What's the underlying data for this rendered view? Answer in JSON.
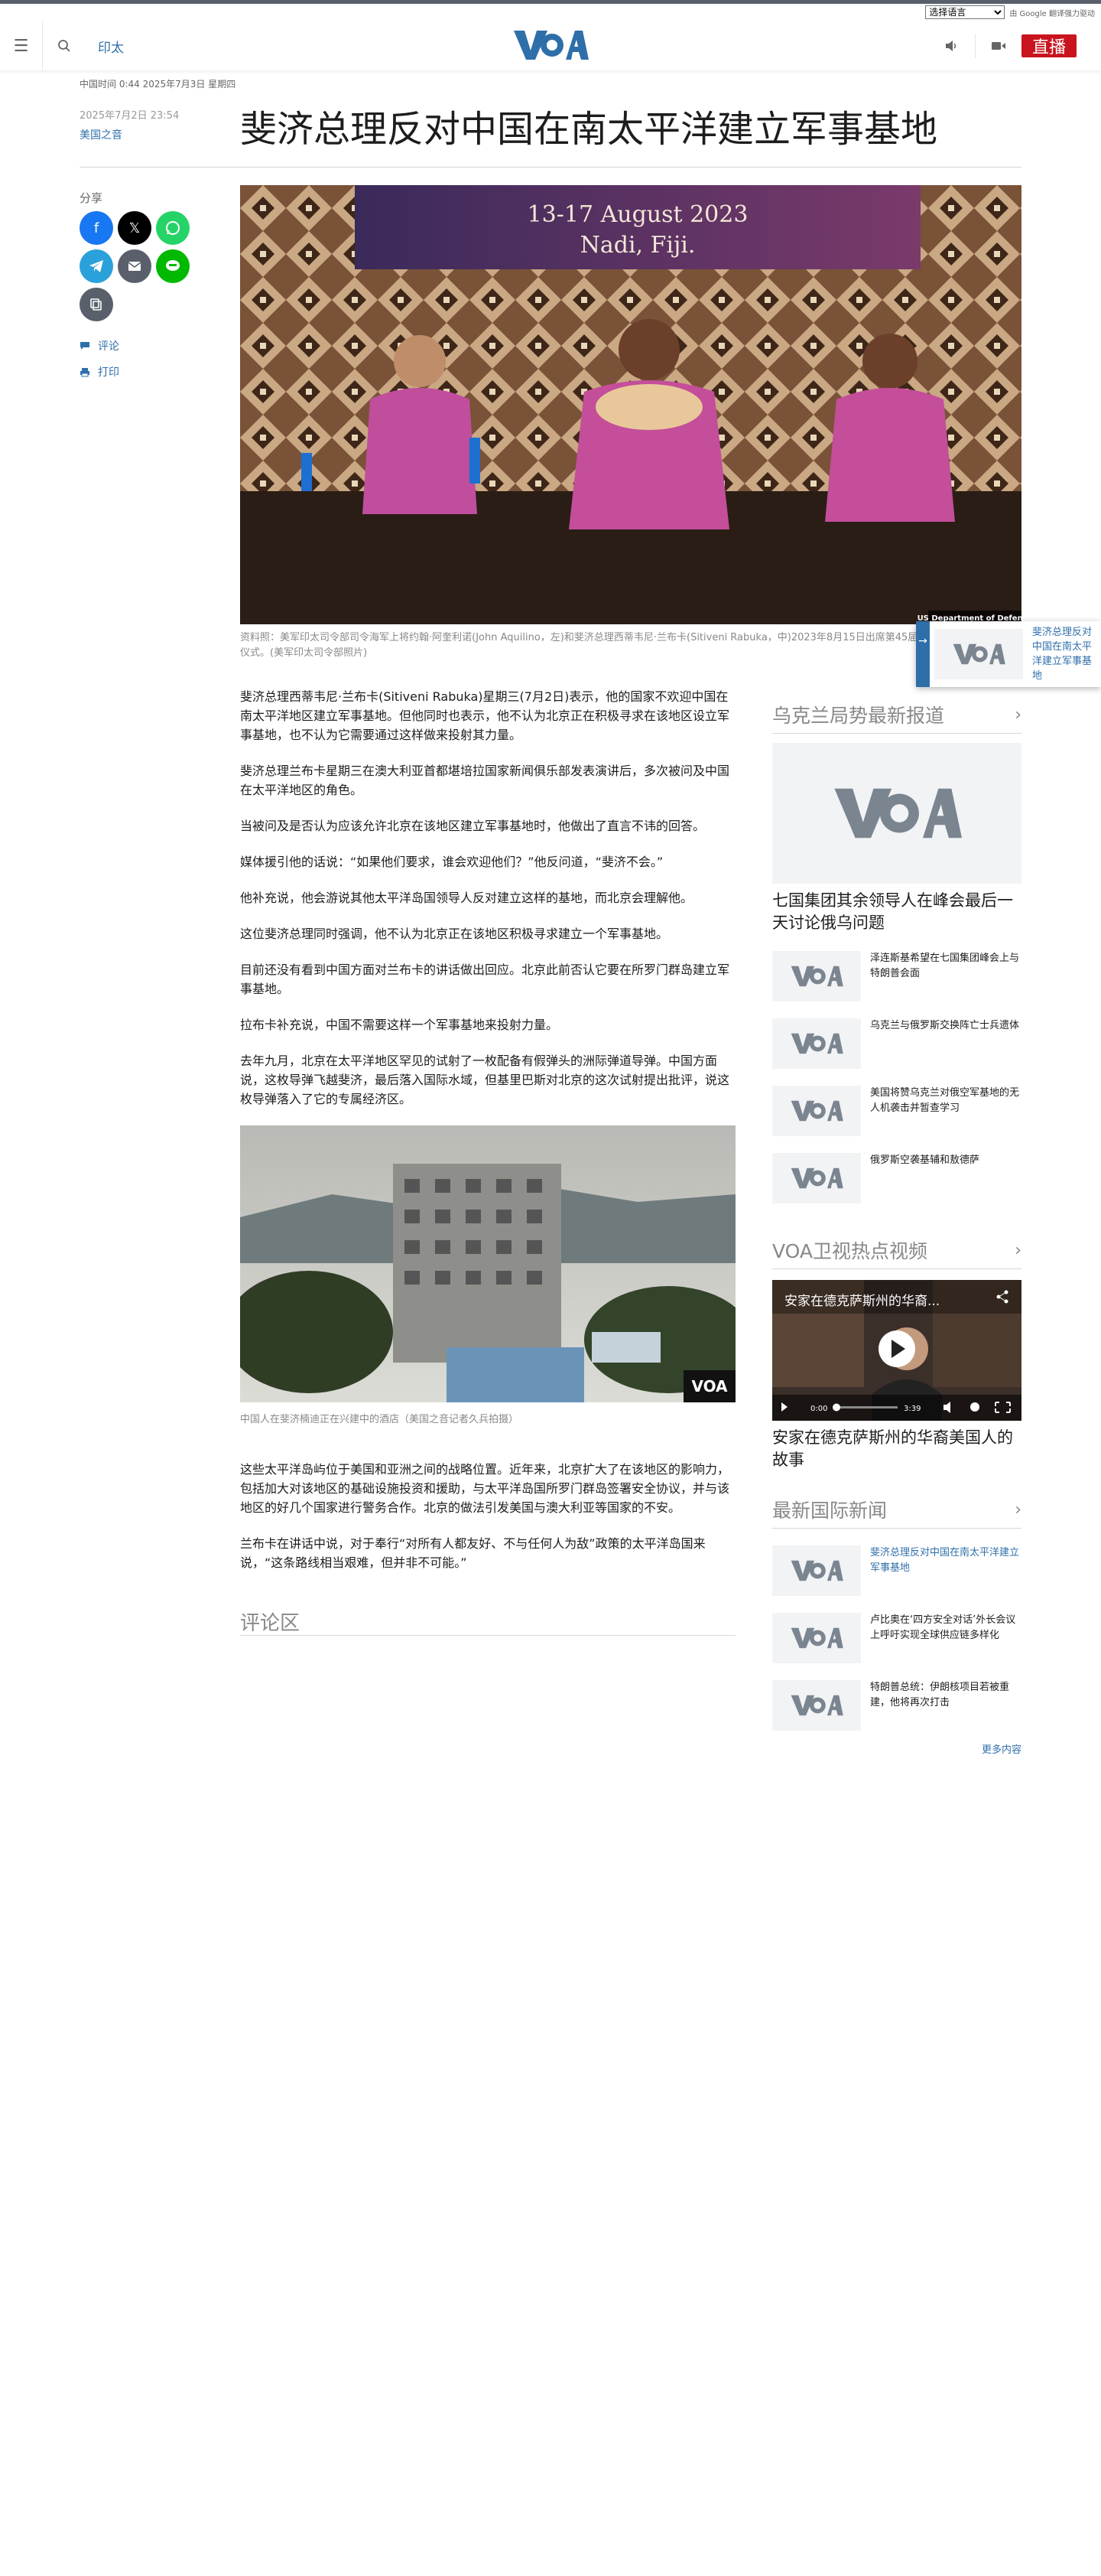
{
  "translate": {
    "select_value": "选择语言",
    "powered": "由 Google 翻译强力驱动"
  },
  "header": {
    "region": "印太",
    "live": "直播"
  },
  "article": {
    "timeline": "中国时间 0:44 2025年7月3日 星期四",
    "pubdate": "2025年7月2日 23:54",
    "source": "美国之音",
    "title": "斐济总理反对中国在南太平洋建立军事基地",
    "share_label": "分享",
    "comment_link": "评论",
    "print_link": "打印",
    "hero_banner_line1": "13-17 August 2023",
    "hero_banner_line2": "Nadi, Fiji.",
    "hero_credit": "US Department of Defense",
    "hero_caption": "资料照：美军印太司令部司令海军上将约翰·阿奎利诺(John Aquilino，左)和斐济总理西蒂韦尼·兰布卡(Sitiveni Rabuka，中)2023年8月15日出席第45届印太军事首长会议开幕仪式。(美军印太司令部照片)",
    "paragraphs": [
      "斐济总理西蒂韦尼·兰布卡(Sitiveni Rabuka)星期三(7月2日)表示，他的国家不欢迎中国在南太平洋地区建立军事基地。但他同时也表示，他不认为北京正在积极寻求在该地区设立军事基地，也不认为它需要通过这样做来投射其力量。",
      "斐济总理兰布卡星期三在澳大利亚首都堪培拉国家新闻俱乐部发表演讲后，多次被问及中国在太平洋地区的角色。",
      "当被问及是否认为应该允许北京在该地区建立军事基地时，他做出了直言不讳的回答。",
      "媒体援引他的话说：“如果他们要求，谁会欢迎他们？”他反问道，“斐济不会。”",
      "他补充说，他会游说其他太平洋岛国领导人反对建立这样的基地，而北京会理解他。",
      "这位斐济总理同时强调，他不认为北京正在该地区积极寻求建立一个军事基地。",
      "目前还没有看到中国方面对兰布卡的讲话做出回应。北京此前否认它要在所罗门群岛建立军事基地。",
      "拉布卡补充说，中国不需要这样一个军事基地来投射力量。",
      "去年九月，北京在太平洋地区罕见的试射了一枚配备有假弹头的洲际弹道导弹。中国方面说，这枚导弹飞越斐济，最后落入国际水域，但基里巴斯对北京的这次试射提出批评，说这枚导弹落入了它的专属经济区。"
    ],
    "fig2_caption": "中国人在斐济楠迪正在兴建中的酒店（美国之音记者久兵拍摄）",
    "fig2_logo": "VOA",
    "paragraphs2": [
      "这些太平洋岛屿位于美国和亚洲之间的战略位置。近年来，北京扩大了在该地区的影响力，包括加大对该地区的基础设施投资和援助，与太平洋岛国所罗门群岛签署安全协议，并与该地区的好几个国家进行警务合作。北京的做法引发美国与澳大利亚等国家的不安。",
      "兰布卡在讲话中说，对于奉行“对所有人都友好、不与任何人为敌”政策的太平洋岛国来说，“这条路线相当艰难，但并非不可能。”"
    ],
    "comments_heading": "评论区"
  },
  "rail": {
    "ukraine": {
      "heading": "乌克兰局势最新报道",
      "big_title": "七国集团其余领导人在峰会最后一天讨论俄乌问题",
      "items": [
        "泽连斯基希望在七国集团峰会上与特朗普会面",
        "乌克兰与俄罗斯交换阵亡士兵遗体",
        "美国将赞乌克兰对俄空军基地的无人机袭击并暂查学习",
        "俄罗斯空袭基辅和敖德萨"
      ]
    },
    "tv": {
      "heading": "VOA卫视热点视频",
      "video_title": "安家在德克萨斯州的华裔...",
      "time_current": "0:00",
      "time_total": "3:39",
      "title": "安家在德克萨斯州的华裔美国人的故事"
    },
    "intl": {
      "heading": "最新国际新闻",
      "items": [
        "斐济总理反对中国在南太平洋建立军事基地",
        "卢比奥在‘四方安全对话’外长会议上呼吁实现全球供应链多样化",
        "特朗普总统：伊朗核项目若被重建，他将再次打击"
      ],
      "more": "更多内容"
    }
  },
  "floater": {
    "title": "斐济总理反对中国在南太平洋建立军事基地"
  },
  "colors": {
    "brand": "#2e6faa",
    "live": "#c9141f",
    "text": "#1d1d1d",
    "muted": "#888888"
  }
}
